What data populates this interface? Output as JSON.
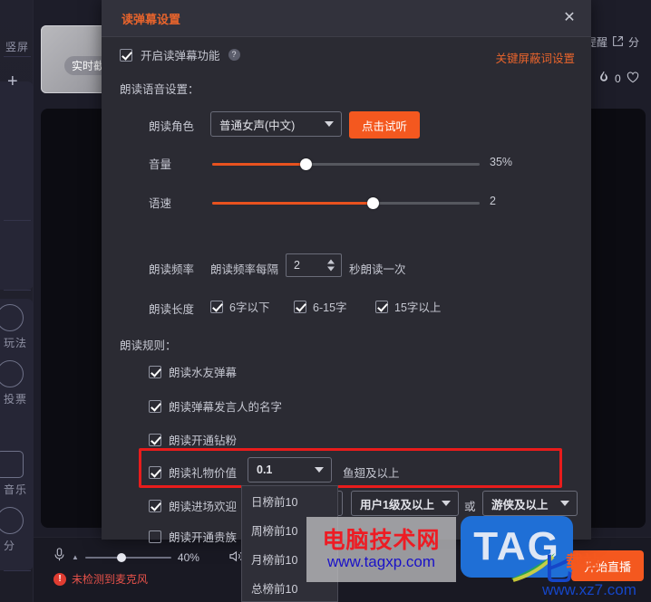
{
  "background": {
    "rail": {
      "tab_label": "竖屏",
      "add_label": "+",
      "items": [
        {
          "label": "玩法",
          "icon": "smiley-icon"
        },
        {
          "label": "投票",
          "icon": "smiley-icon"
        },
        {
          "label": "音乐",
          "icon": "music-icon"
        },
        {
          "label": "分",
          "icon": "chat-icon"
        }
      ]
    },
    "thumb_label": "实时截",
    "topright": {
      "reminder_label": "番提醒",
      "share_label": "分",
      "share_icon": "share-icon",
      "hot_icon": "fire-icon",
      "hot_count": "0",
      "like_icon": "heart-icon"
    },
    "bottombar": {
      "mic_icon": "microphone-icon",
      "caret_icon": "caret-up-icon",
      "volume_percent": "40%",
      "warning_text": "未检测到麦克风",
      "warning_icon": "exclamation-icon",
      "speaker_icon": "speaker-icon",
      "golive_label": "开始直播"
    }
  },
  "modal": {
    "title": "读弹幕设置",
    "close_icon": "close-icon",
    "enable": {
      "label": "开启读弹幕功能",
      "checked": true,
      "help_icon": "question-icon",
      "help_glyph": "?"
    },
    "keyword_link": "关键屏蔽词设置",
    "voice_section_title": "朗读语音设置：",
    "role": {
      "label": "朗读角色",
      "value": "普通女声(中文)",
      "listen_button": "点击试听"
    },
    "volume": {
      "label": "音量",
      "value": "35%",
      "percent": 35
    },
    "speed": {
      "label": "语速",
      "value": "2",
      "percent": 60
    },
    "frequency": {
      "label": "朗读频率",
      "prefix": "朗读频率每隔",
      "value": "2",
      "suffix": "秒朗读一次"
    },
    "length": {
      "label": "朗读长度",
      "options": [
        {
          "label": "6字以下",
          "checked": true
        },
        {
          "label": "6-15字",
          "checked": true
        },
        {
          "label": "15字以上",
          "checked": true
        }
      ]
    },
    "rules_title": "朗读规则：",
    "rules": [
      {
        "label": "朗读水友弹幕",
        "checked": true
      },
      {
        "label": "朗读弹幕发言人的名字",
        "checked": true
      },
      {
        "label": "朗读开通钻粉",
        "checked": true
      }
    ],
    "gift": {
      "label": "朗读礼物价值",
      "checked": true,
      "value": "0.1",
      "suffix": "鱼翅及以上"
    },
    "welcome": {
      "label": "朗读进场欢迎",
      "checked": true,
      "rank_value": "周榜前10",
      "level_value": "用户1级及以上",
      "conjunction": "或",
      "badge_value": "游侠及以上",
      "highlight_color": "#e81c1c"
    },
    "noble": {
      "label": "朗读开通贵族",
      "checked": false
    },
    "rank_dropdown_options": [
      "日榜前10",
      "周榜前10",
      "月榜前10",
      "总榜前10"
    ]
  },
  "watermarks": {
    "tagxp_cn": "电脑技术网",
    "tagxp_url": "www.tagxp.com",
    "tag_logo": "TAG",
    "xz_url": "www.xz7.com",
    "xz_text": "载站"
  },
  "colors": {
    "accent_orange": "#f4581f",
    "title_orange": "#e8642c",
    "highlight_red": "#e81c1c",
    "modal_bg": "#2b2b33"
  }
}
